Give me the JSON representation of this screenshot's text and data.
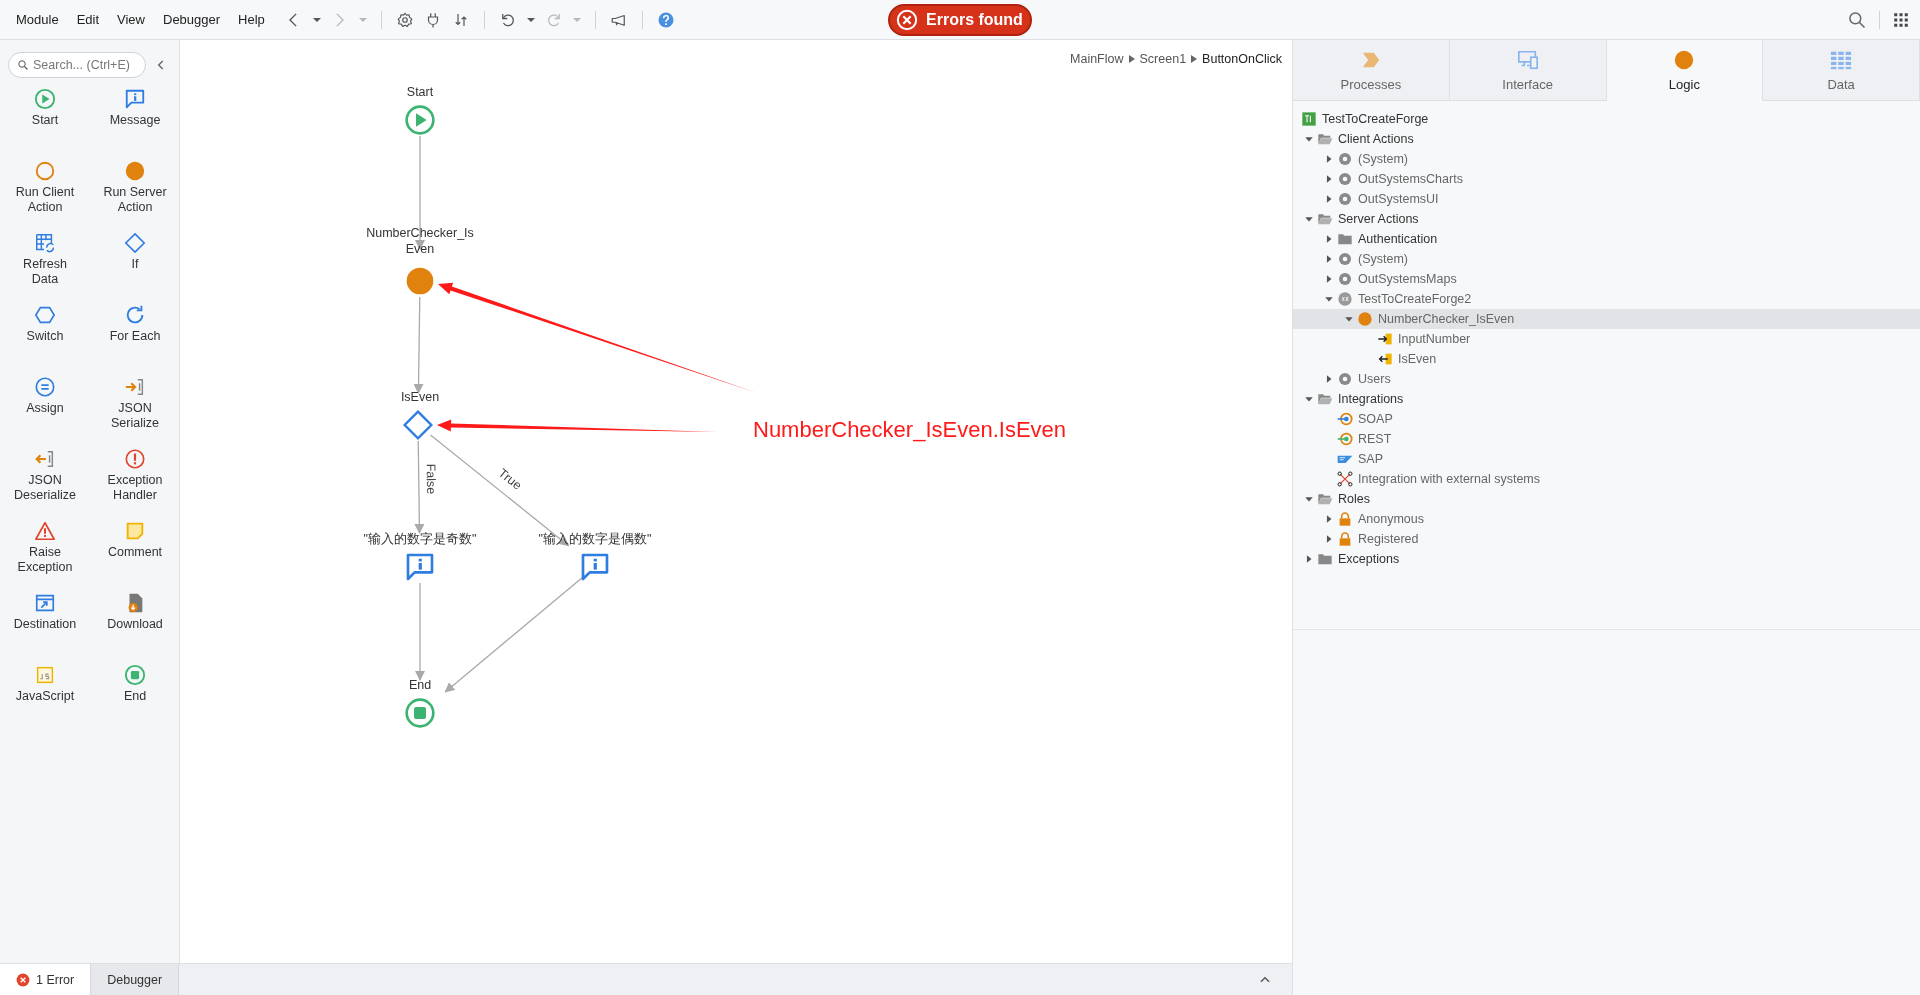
{
  "menu": [
    "Module",
    "Edit",
    "View",
    "Debugger",
    "Help"
  ],
  "toolbar": [
    {
      "kind": "back",
      "disabled": false
    },
    {
      "kind": "dropdown",
      "disabled": false
    },
    {
      "kind": "forward",
      "disabled": true
    },
    {
      "kind": "dropdown",
      "disabled": true
    },
    {
      "kind": "separator"
    },
    {
      "kind": "settings",
      "disabled": false
    },
    {
      "kind": "plug",
      "disabled": false
    },
    {
      "kind": "transfer",
      "disabled": false
    },
    {
      "kind": "separator"
    },
    {
      "kind": "undo",
      "disabled": false
    },
    {
      "kind": "dropdown",
      "disabled": false
    },
    {
      "kind": "redo",
      "disabled": true
    },
    {
      "kind": "dropdown",
      "disabled": true
    },
    {
      "kind": "separator"
    },
    {
      "kind": "megaphone",
      "disabled": false
    },
    {
      "kind": "separator"
    },
    {
      "kind": "help"
    }
  ],
  "error_badge": "Errors found",
  "palette": {
    "search": {
      "placeholder": "Search... (Ctrl+E)"
    },
    "items": [
      {
        "label": "Start",
        "kind": "start"
      },
      {
        "label": "Message",
        "kind": "message"
      },
      {
        "label": "Run Client Action",
        "kind": "run-client"
      },
      {
        "label": "Run Server Action",
        "kind": "run-server"
      },
      {
        "label": "Refresh Data",
        "kind": "refresh"
      },
      {
        "label": "If",
        "kind": "if"
      },
      {
        "label": "Switch",
        "kind": "switch"
      },
      {
        "label": "For Each",
        "kind": "foreach"
      },
      {
        "label": "Assign",
        "kind": "assign"
      },
      {
        "label": "JSON Serialize",
        "kind": "json-serialize"
      },
      {
        "label": "JSON Deserialize",
        "kind": "json-deserialize"
      },
      {
        "label": "Exception Handler",
        "kind": "exception-handler"
      },
      {
        "label": "Raise Exception",
        "kind": "raise-exception"
      },
      {
        "label": "Comment",
        "kind": "comment"
      },
      {
        "label": "Destination",
        "kind": "destination"
      },
      {
        "label": "Download",
        "kind": "download"
      },
      {
        "label": "JavaScript",
        "kind": "javascript"
      },
      {
        "label": "End",
        "kind": "end"
      }
    ]
  },
  "breadcrumb": [
    "MainFlow",
    "Screen1",
    "ButtonOnClick"
  ],
  "flow": {
    "nodes": [
      {
        "label": "Start",
        "kind": "start"
      },
      {
        "label": "NumberChecker_Is Even",
        "kind": "run-server"
      },
      {
        "label": "IsEven",
        "kind": "if"
      },
      {
        "label": "\"输入的数字是奇数\"",
        "kind": "message"
      },
      {
        "label": "\"输入的数字是偶数\"",
        "kind": "message"
      },
      {
        "label": "End",
        "kind": "end"
      }
    ],
    "branch_labels": [
      "False",
      "True"
    ],
    "annotation": "NumberChecker_IsEven.IsEven"
  },
  "side_tabs": [
    {
      "label": "Processes",
      "kind": "processes",
      "selected": false
    },
    {
      "label": "Interface",
      "kind": "interface",
      "selected": false
    },
    {
      "label": "Logic",
      "kind": "logic",
      "selected": true
    },
    {
      "label": "Data",
      "kind": "data",
      "selected": false
    }
  ],
  "tree": [
    {
      "label": "TestToCreateForge",
      "kind": "module",
      "selected": false,
      "children": [
        {
          "label": "Client Actions",
          "kind": "folder",
          "expanded": true,
          "selected": false,
          "children": [
            {
              "label": "(System)",
              "kind": "component",
              "expanded": false,
              "selected": false
            },
            {
              "label": "OutSystemsCharts",
              "kind": "component",
              "expanded": false,
              "selected": false
            },
            {
              "label": "OutSystemsUI",
              "kind": "component",
              "expanded": false,
              "selected": false
            }
          ]
        },
        {
          "label": "Server Actions",
          "kind": "folder",
          "expanded": true,
          "selected": false,
          "children": [
            {
              "label": "Authentication",
              "kind": "folder",
              "expanded": false,
              "selected": false
            },
            {
              "label": "(System)",
              "kind": "component",
              "expanded": false,
              "selected": false
            },
            {
              "label": "OutSystemsMaps",
              "kind": "component",
              "expanded": false,
              "selected": false
            },
            {
              "label": "TestToCreateForge2",
              "kind": "extension",
              "expanded": true,
              "selected": false,
              "children": [
                {
                  "label": "NumberChecker_IsEven",
                  "kind": "server-action",
                  "expanded": true,
                  "selected": true,
                  "children": [
                    {
                      "label": "InputNumber",
                      "kind": "input-parameter",
                      "selected": false
                    },
                    {
                      "label": "IsEven",
                      "kind": "output-parameter",
                      "selected": false
                    }
                  ]
                }
              ]
            },
            {
              "label": "Users",
              "kind": "component",
              "expanded": false,
              "selected": false
            }
          ]
        },
        {
          "label": "Integrations",
          "kind": "folder",
          "expanded": true,
          "selected": false,
          "children": [
            {
              "label": "SOAP",
              "kind": "soap",
              "selected": false
            },
            {
              "label": "REST",
              "kind": "rest",
              "selected": false
            },
            {
              "label": "SAP",
              "kind": "sap",
              "selected": false
            },
            {
              "label": "Integration with external systems",
              "kind": "integration",
              "selected": false
            }
          ]
        },
        {
          "label": "Roles",
          "kind": "folder",
          "expanded": true,
          "selected": false,
          "children": [
            {
              "label": "Anonymous",
              "kind": "role",
              "expanded": false,
              "selected": false
            },
            {
              "label": "Registered",
              "kind": "role",
              "expanded": false,
              "selected": false
            }
          ]
        },
        {
          "label": "Exceptions",
          "kind": "folder",
          "expanded": false,
          "selected": false
        }
      ]
    }
  ],
  "bottom_tabs": [
    {
      "label": "1 Error",
      "kind": "errors",
      "selected": true
    },
    {
      "label": "Debugger",
      "kind": "debugger",
      "selected": false
    }
  ]
}
